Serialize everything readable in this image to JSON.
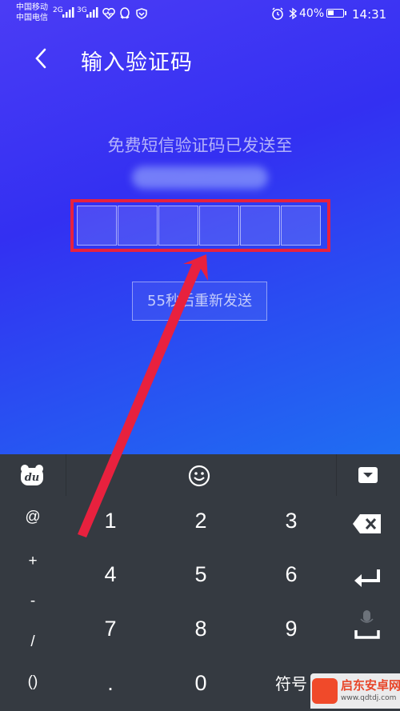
{
  "status_bar": {
    "carrier_1": "中国移动",
    "carrier_2": "中国电信",
    "network_1": "2G",
    "network_2": "3G",
    "battery_text": "40%",
    "battery_level": 0.4,
    "time": "14:31"
  },
  "header": {
    "title": "输入验证码",
    "back_icon": "chevron-left-icon"
  },
  "content": {
    "sent_label": "免费短信验证码已发送至",
    "code_length": 6,
    "resend_label": "55秒后重新发送"
  },
  "keyboard": {
    "toolbar": {
      "logo_text": "du",
      "emoji_icon": "smiley-icon",
      "hide_icon": "keyboard-hide-icon"
    },
    "side_keys": [
      "@",
      "+",
      "-",
      "/",
      "()"
    ],
    "number_rows": [
      [
        "1",
        "2",
        "3"
      ],
      [
        "4",
        "5",
        "6"
      ],
      [
        "7",
        "8",
        "9"
      ],
      [
        ".",
        "0",
        "符号"
      ]
    ],
    "right_keys": {
      "delete_icon": "backspace-icon",
      "enter_icon": "enter-icon",
      "space_icon": "mic-space-icon"
    }
  },
  "watermark": {
    "name": "启东安卓网",
    "url": "www.qdtdj.com"
  },
  "colors": {
    "accent_red": "#e8213e",
    "keyboard_bg": "#353a41",
    "gradient_top": "#4b3cf5",
    "gradient_bottom": "#1f6ef2"
  }
}
